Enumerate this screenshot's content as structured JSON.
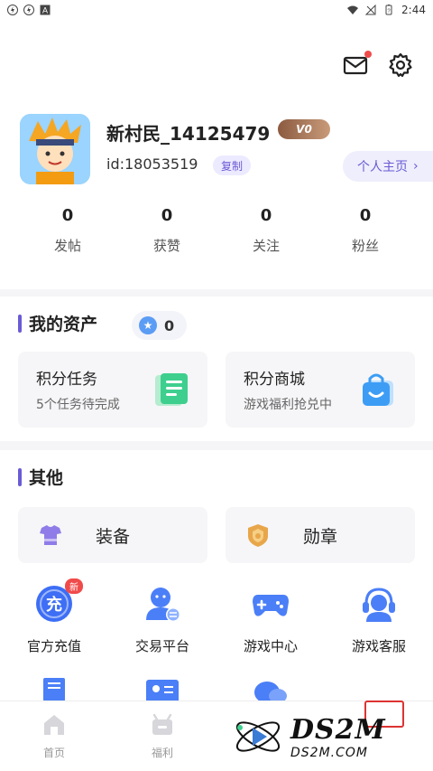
{
  "status_bar": {
    "time": "2:44"
  },
  "header": {
    "username": "新村民_14125479",
    "vip_level": "V0",
    "user_id": "id:18053519",
    "copy_label": "复制",
    "homepage_label": "个人主页",
    "stats": [
      {
        "value": "0",
        "label": "发帖"
      },
      {
        "value": "0",
        "label": "获赞"
      },
      {
        "value": "0",
        "label": "关注"
      },
      {
        "value": "0",
        "label": "粉丝"
      }
    ]
  },
  "assets": {
    "title": "我的资产",
    "coin_count": "0",
    "cards": [
      {
        "title": "积分任务",
        "subtitle": "5个任务待完成",
        "icon": "task-list-icon"
      },
      {
        "title": "积分商城",
        "subtitle": "游戏福利抢兑中",
        "icon": "shopping-bag-icon"
      }
    ]
  },
  "others": {
    "title": "其他",
    "wide_buttons": [
      {
        "label": "装备",
        "icon": "tshirt-icon"
      },
      {
        "label": "勋章",
        "icon": "medal-icon"
      }
    ],
    "grid": [
      {
        "label": "官方充值",
        "icon": "recharge-icon",
        "badge": "新",
        "glyph": "充"
      },
      {
        "label": "交易平台",
        "icon": "trade-user-icon"
      },
      {
        "label": "游戏中心",
        "icon": "gamepad-icon"
      },
      {
        "label": "游戏客服",
        "icon": "headset-icon"
      }
    ]
  },
  "tabbar": {
    "tabs": [
      {
        "label": "首页",
        "icon": "home-icon"
      },
      {
        "label": "福利",
        "icon": "gift-icon"
      }
    ]
  },
  "watermark": {
    "big": "DS2M",
    "small": "DS2M.COM"
  },
  "colors": {
    "accent": "#6a5bd6",
    "badge_red": "#f04b4b",
    "vip_brown": "#8b5a40"
  }
}
